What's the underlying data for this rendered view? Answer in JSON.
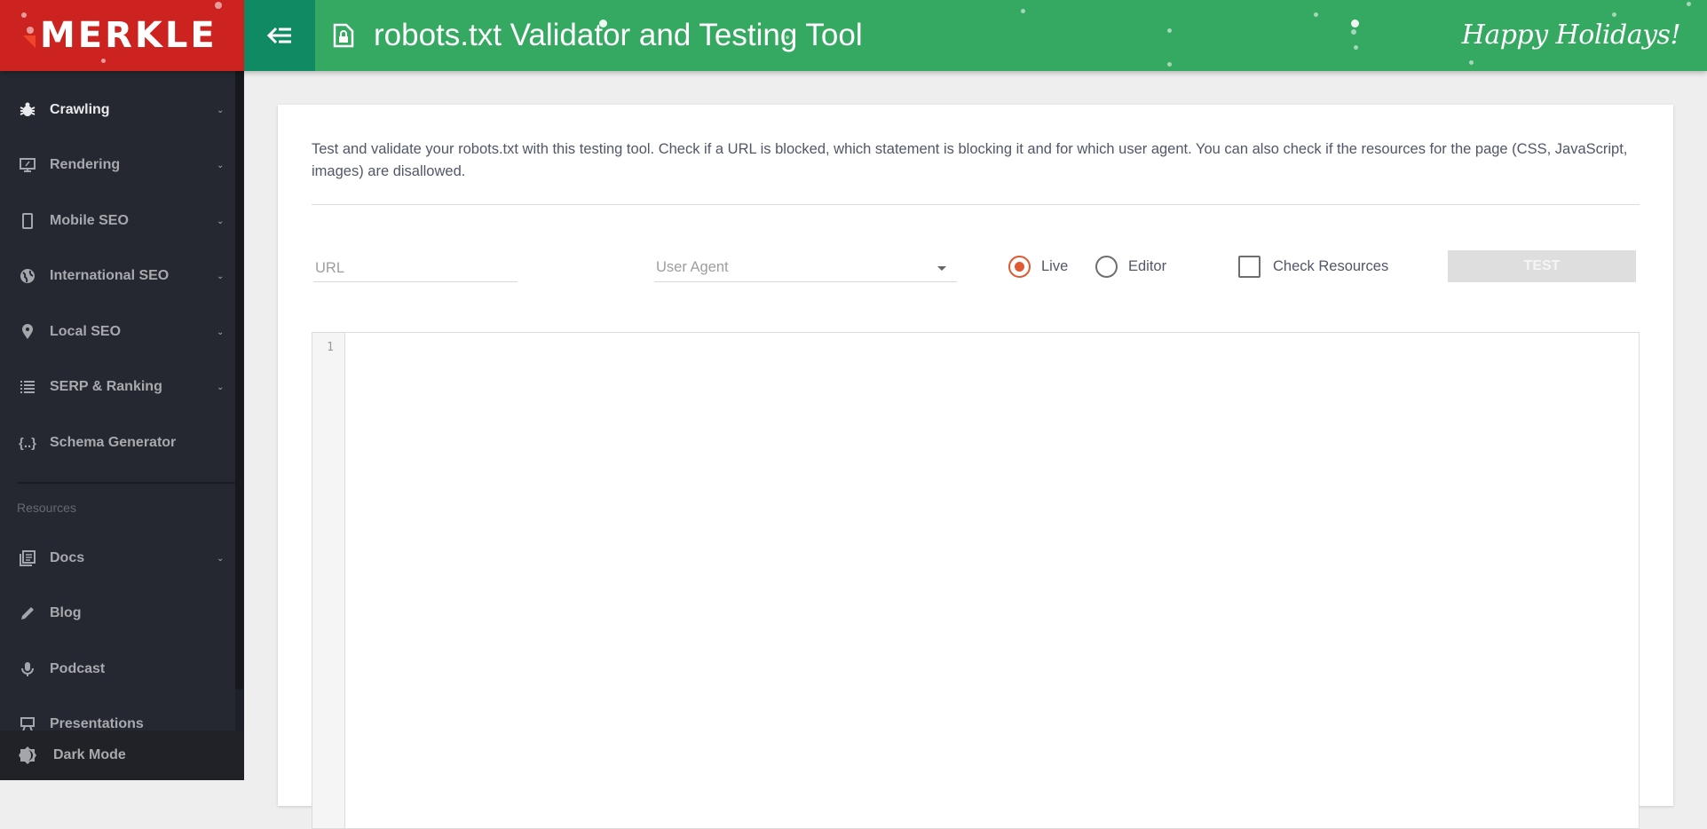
{
  "header": {
    "logo": "MERKLE",
    "toggle_icon": "collapse-menu-icon",
    "page_icon": "file-lock-icon",
    "title": "robots.txt Validator and Testing Tool",
    "greeting": "Happy Holidays!",
    "colors": {
      "logo_bg": "#cc2220",
      "toggle_bg": "#0f8a62",
      "title_bg": "#35a862"
    }
  },
  "sidebar": {
    "items": [
      {
        "label": "Crawling",
        "icon": "bug-icon",
        "expandable": true,
        "active": true
      },
      {
        "label": "Rendering",
        "icon": "monitor-icon",
        "expandable": true
      },
      {
        "label": "Mobile SEO",
        "icon": "mobile-icon",
        "expandable": true
      },
      {
        "label": "International SEO",
        "icon": "globe-icon",
        "expandable": true
      },
      {
        "label": "Local SEO",
        "icon": "map-pin-icon",
        "expandable": true
      },
      {
        "label": "SERP & Ranking",
        "icon": "list-icon",
        "expandable": true
      },
      {
        "label": "Schema Generator",
        "icon": "braces-icon",
        "expandable": false
      }
    ],
    "section_label": "Resources",
    "resources": [
      {
        "label": "Docs",
        "icon": "docs-icon",
        "expandable": true
      },
      {
        "label": "Blog",
        "icon": "pencil-icon",
        "expandable": false
      },
      {
        "label": "Podcast",
        "icon": "microphone-icon",
        "expandable": false
      },
      {
        "label": "Presentations",
        "icon": "presentation-icon",
        "expandable": false
      }
    ],
    "dark_mode_label": "Dark Mode"
  },
  "main": {
    "description": "Test and validate your robots.txt with this testing tool. Check if a URL is blocked, which statement is blocking it and for which user agent. You can also check if the resources for the page (CSS, JavaScript, images) are disallowed.",
    "url_field": {
      "placeholder": "URL",
      "value": ""
    },
    "user_agent_select": {
      "placeholder": "User Agent",
      "value": ""
    },
    "mode_options": [
      {
        "label": "Live",
        "checked": true
      },
      {
        "label": "Editor",
        "checked": false
      }
    ],
    "check_resources": {
      "label": "Check Resources",
      "checked": false
    },
    "test_button": "TEST",
    "editor": {
      "line_numbers": [
        "1"
      ],
      "content": ""
    },
    "accent_color": "#e05a32"
  }
}
